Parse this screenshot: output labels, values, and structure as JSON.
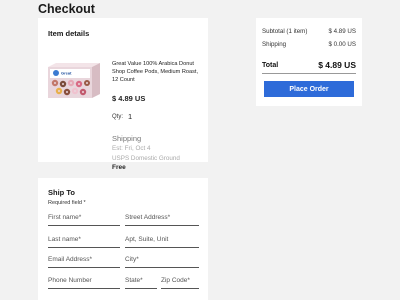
{
  "page": {
    "title": "Checkout"
  },
  "item_details": {
    "heading": "Item details",
    "product_name": "Great Value 100% Arabica Donut Shop Coffee Pods, Medium Roast, 12 Count",
    "price": "$ 4.89 US",
    "qty_label": "Qty:",
    "qty_value": "1",
    "shipping_title": "Shipping",
    "shipping_date": "Est: Fri, Oct 4",
    "shipping_method": "USPS Domestic Ground",
    "shipping_cost": "Free"
  },
  "summary": {
    "subtotal_label": "Subtotal (1 item)",
    "subtotal_value": "$ 4.89 US",
    "shipping_label": "Shipping",
    "shipping_value": "$ 0.00 US",
    "total_label": "Total",
    "total_value": "$ 4.89 US",
    "place_order_label": "Place Order",
    "accent_color": "#2e6bd9"
  },
  "ship_to": {
    "heading": "Ship To",
    "required_note": "Required field *",
    "fields": {
      "first_name": "First name*",
      "street_address": "Street Address*",
      "last_name": "Last name*",
      "apt": "Apt, Suite, Unit",
      "email": "Email Address*",
      "city": "City*",
      "phone": "Phone Number",
      "state": "State*",
      "zip": "Zip Code*"
    }
  }
}
